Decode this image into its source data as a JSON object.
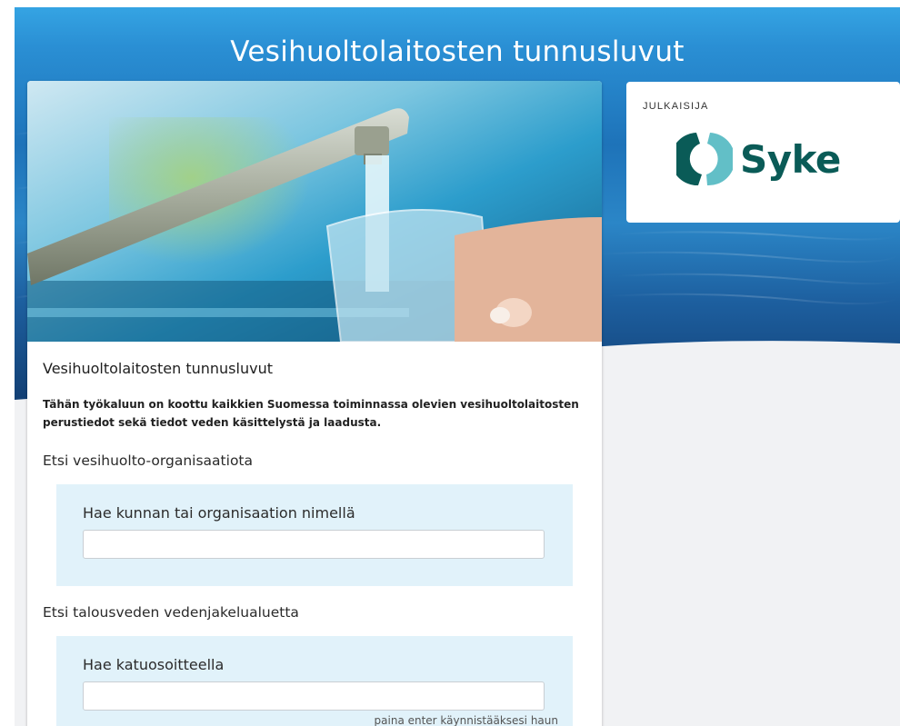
{
  "header": {
    "title": "Vesihuoltolaitosten tunnusluvut"
  },
  "hero_image": {
    "description": "tap-water-into-glass-photo"
  },
  "card": {
    "title": "Vesihuoltolaitosten tunnusluvut",
    "description": "Tähän työkaluun on koottu kaikkien Suomessa toiminnassa olevien vesihuoltolaitosten perustiedot sekä tiedot veden käsittelystä ja laadusta.",
    "org_search": {
      "heading": "Etsi vesihuolto-organisaatiota",
      "label": "Hae kunnan tai organisaation nimellä",
      "value": "",
      "placeholder": ""
    },
    "area_search": {
      "heading": "Etsi talousveden vedenjakelualuetta",
      "label": "Hae katuosoitteella",
      "value": "",
      "placeholder": "",
      "hint": "paina enter käynnistääksesi haun"
    }
  },
  "publisher": {
    "label": "JULKAISIJA",
    "logo_text": "Syke",
    "logo_icon": "syke-logo-icon"
  },
  "colors": {
    "header_blue": "#2f9ee0",
    "panel_bg": "#e1f2fa",
    "logo_dark": "#0a5b57",
    "logo_light": "#62bfc7"
  }
}
